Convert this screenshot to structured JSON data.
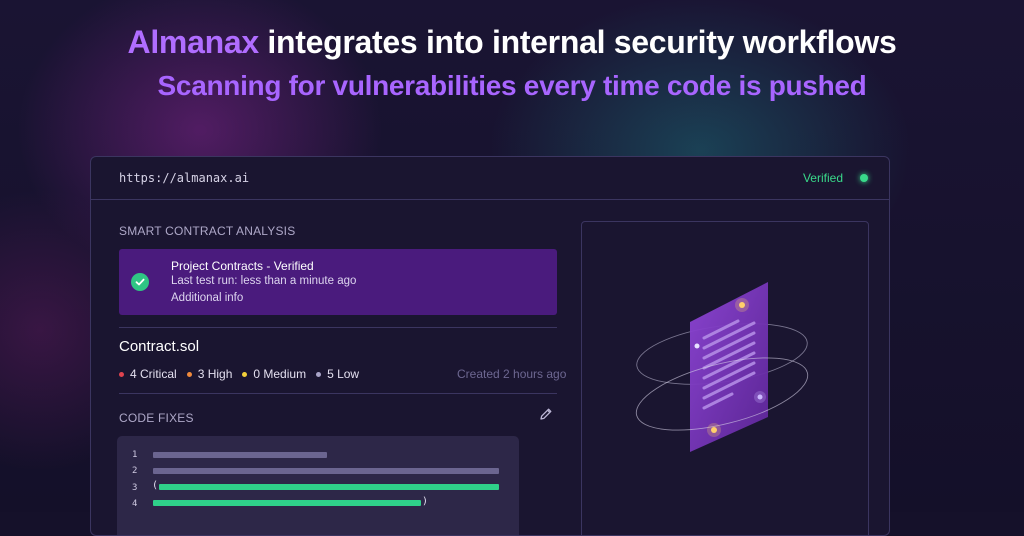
{
  "hero": {
    "brand": "Almanax",
    "headline_rest": " integrates into internal security workflows",
    "subheadline": "Scanning for vulnerabilities every time code is pushed"
  },
  "window": {
    "url": "https://almanax.ai",
    "status": "Verified",
    "status_color": "#39d98a"
  },
  "analysis": {
    "section_label": "SMART CONTRACT ANALYSIS",
    "project": {
      "title": "Project Contracts - Verified",
      "last_run": "Last test run: less than a minute ago",
      "info": "Additional info"
    }
  },
  "contract": {
    "name": "Contract.sol",
    "severities": [
      {
        "label": "4 Critical",
        "color": "#e0434f"
      },
      {
        "label": "3 High",
        "color": "#f08a3c"
      },
      {
        "label": "0 Medium",
        "color": "#f2cf3a"
      },
      {
        "label": "5 Low",
        "color": "#a9a4c8"
      }
    ],
    "created": "Created 2 hours ago"
  },
  "code_fixes": {
    "section_label": "CODE FIXES",
    "edit_icon": "pencil-icon",
    "lines": [
      {
        "number": "1",
        "kind": "plain"
      },
      {
        "number": "2",
        "kind": "plain"
      },
      {
        "number": "3",
        "kind": "added",
        "prefix": "("
      },
      {
        "number": "4",
        "kind": "added",
        "suffix": ")"
      }
    ]
  },
  "illustration": {
    "icon": "scanned-document-icon",
    "accent": "#7b35c2"
  }
}
